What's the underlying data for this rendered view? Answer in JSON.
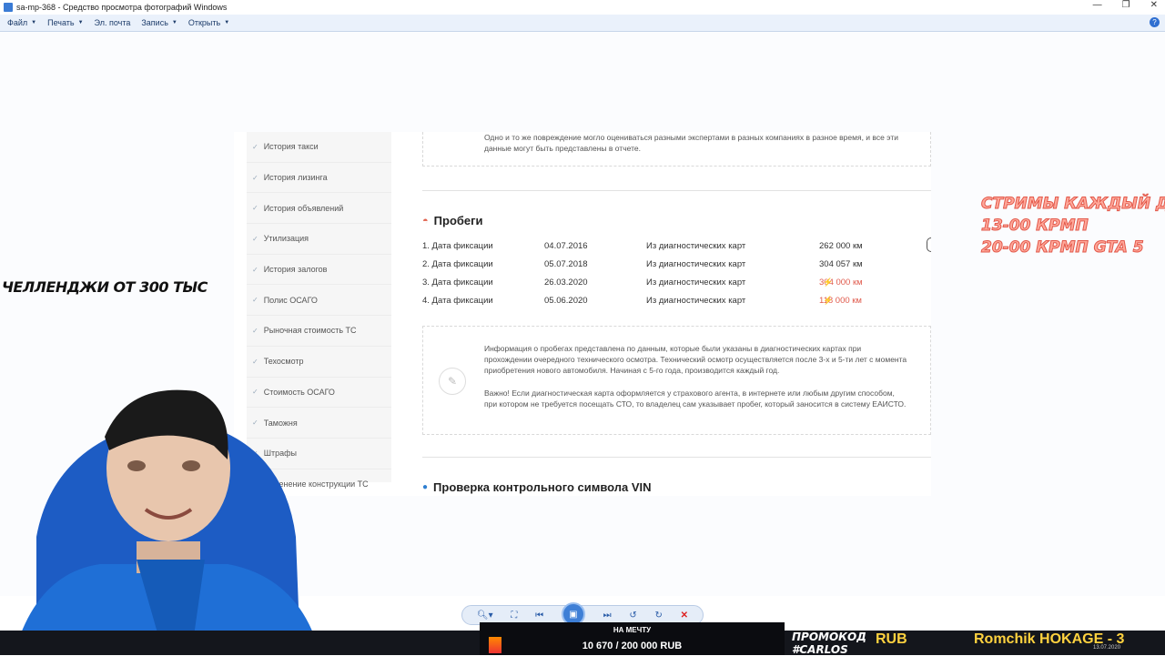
{
  "window": {
    "title": "sa-mp-368 - Средство просмотра фотографий Windows",
    "controls": [
      "—",
      "❐",
      "✕"
    ]
  },
  "menu": [
    {
      "label": "Файл",
      "caret": "▼"
    },
    {
      "label": "Печать",
      "caret": "▼"
    },
    {
      "label": "Эл. почта",
      "caret": ""
    },
    {
      "label": "Запись",
      "caret": "▼"
    },
    {
      "label": "Открыть",
      "caret": "▼"
    }
  ],
  "help_label": "?",
  "sidebar": {
    "check": "✓",
    "items": [
      "История такси",
      "История лизинга",
      "История объявлений",
      "Утилизация",
      "История залогов",
      "Полис ОСАГО",
      "Рыночная стоимость ТС",
      "Техосмотр",
      "Стоимость ОСАГО",
      "Таможня",
      "Штрафы",
      "Изменение конструкции ТС"
    ]
  },
  "note_top": "Одно и то же повреждение могло оцениваться разными экспертами в разных компаниях в разное время, и все эти данные могут быть представлены в отчете.",
  "mileage": {
    "title": "Пробеги",
    "rows": [
      {
        "label": "1. Дата фиксации",
        "date": "04.07.2016",
        "source": "Из диагностических карт",
        "value": "262 000 км",
        "warn": false
      },
      {
        "label": "2. Дата фиксации",
        "date": "05.07.2018",
        "source": "Из диагностических карт",
        "value": "304 057 км",
        "warn": false
      },
      {
        "label": "3. Дата фиксации",
        "date": "26.03.2020",
        "source": "Из диагностических карт",
        "value": "304 000 км",
        "warn": true
      },
      {
        "label": "4. Дата фиксации",
        "date": "05.06.2020",
        "source": "Из диагностических карт",
        "value": "118 000 км",
        "warn": true
      }
    ],
    "info_p1": "Информация о пробегах представлена по данным, которые были указаны в диагностических картах при прохождении очередного технического осмотра. Технический осмотр осуществляется после 3-х и 5-ти лет с момента приобретения нового автомобиля. Начиная с 5-го года, производится каждый год.",
    "info_p2": "Важно! Если диагностическая карта оформляется у страхового агента, в интернете или любым другим способом, при котором не требуется посещать СТО, то владелец сам указывает пробег, который заносится в систему ЕАИСТО."
  },
  "vin_title": "Проверка контрольного символа VIN",
  "stream": {
    "right_line1": "СТРИМЫ КАЖДЫЙ ДЕНЬ",
    "right_line2": "13-00 КРМП",
    "right_line3": "20-00 КРМП GTA 5",
    "left_text": "ЧЕЛЛЕНДЖИ ОТ 300 ТЫС",
    "donate_label": "НА МЕЧТУ",
    "donate_amount": "10 670 / 200 000 RUB",
    "promo_line1": "ПРОМОКОД",
    "promo_line2": "#CARLOS",
    "rub": "RUB",
    "ticker": "Romchik HOKAGE - 3",
    "date": "13.07.2020"
  },
  "colors": {
    "accent_red": "#e05a4c",
    "overlay_pink": "#ffa89a",
    "viewer_blue": "#3e7fd6",
    "donate_gold": "#ffd23f"
  }
}
